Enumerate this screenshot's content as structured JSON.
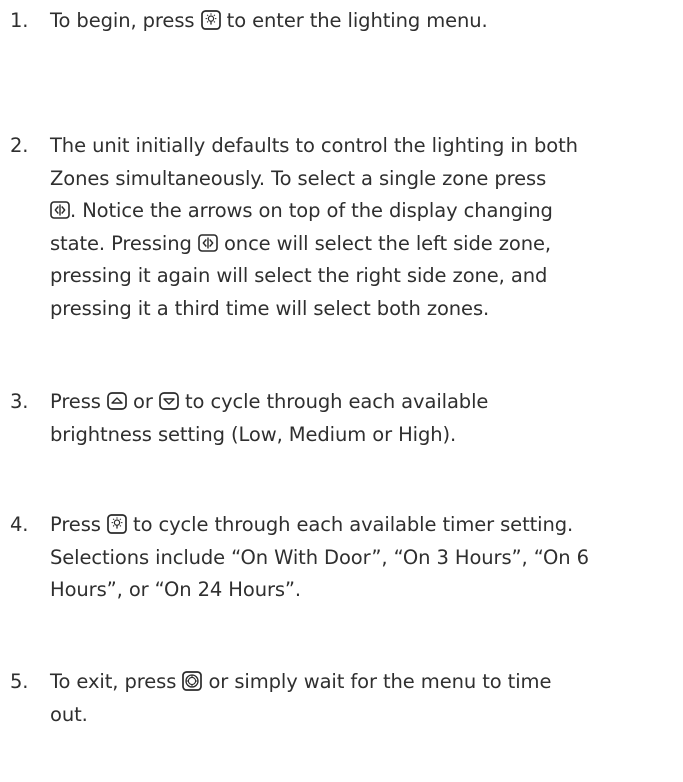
{
  "steps": [
    {
      "number": "1.",
      "lines": [
        {
          "before": "To begin, press ",
          "icon": "light-bulb-icon",
          "after": " to enter the lighting menu."
        }
      ]
    },
    {
      "number": "2.",
      "lines": [
        {
          "text": "The unit initially defaults to control the lighting in both"
        },
        {
          "text": "Zones simultaneously. To select a single zone press"
        },
        {
          "icon": "zone-select-icon",
          "after": ". Notice the arrows on top of the display changing"
        },
        {
          "before": "state. Pressing ",
          "icon": "zone-select-icon",
          "after": " once will select the left side zone,"
        },
        {
          "text": "pressing it again will select the right side zone, and"
        },
        {
          "text": "pressing it a third time will select both zones."
        }
      ]
    },
    {
      "number": "3.",
      "lines": [
        {
          "before": "Press ",
          "icon": "up-arrow-icon",
          "middle": " or ",
          "icon2": "down-arrow-icon",
          "after": " to cycle through each available"
        },
        {
          "text": "brightness setting (Low, Medium or High)."
        }
      ]
    },
    {
      "number": "4.",
      "lines": [
        {
          "before": "Press ",
          "icon": "light-bulb-icon",
          "after": " to cycle through each available timer setting."
        },
        {
          "text": "Selections include “On With Door”, “On 3 Hours”, “On 6"
        },
        {
          "text": "Hours”, or “On 24 Hours”."
        }
      ]
    },
    {
      "number": "5.",
      "lines": [
        {
          "before": "To exit, press ",
          "icon": "exit-button-icon",
          "after": " or simply wait for the menu to time"
        },
        {
          "text": "out."
        }
      ]
    }
  ]
}
